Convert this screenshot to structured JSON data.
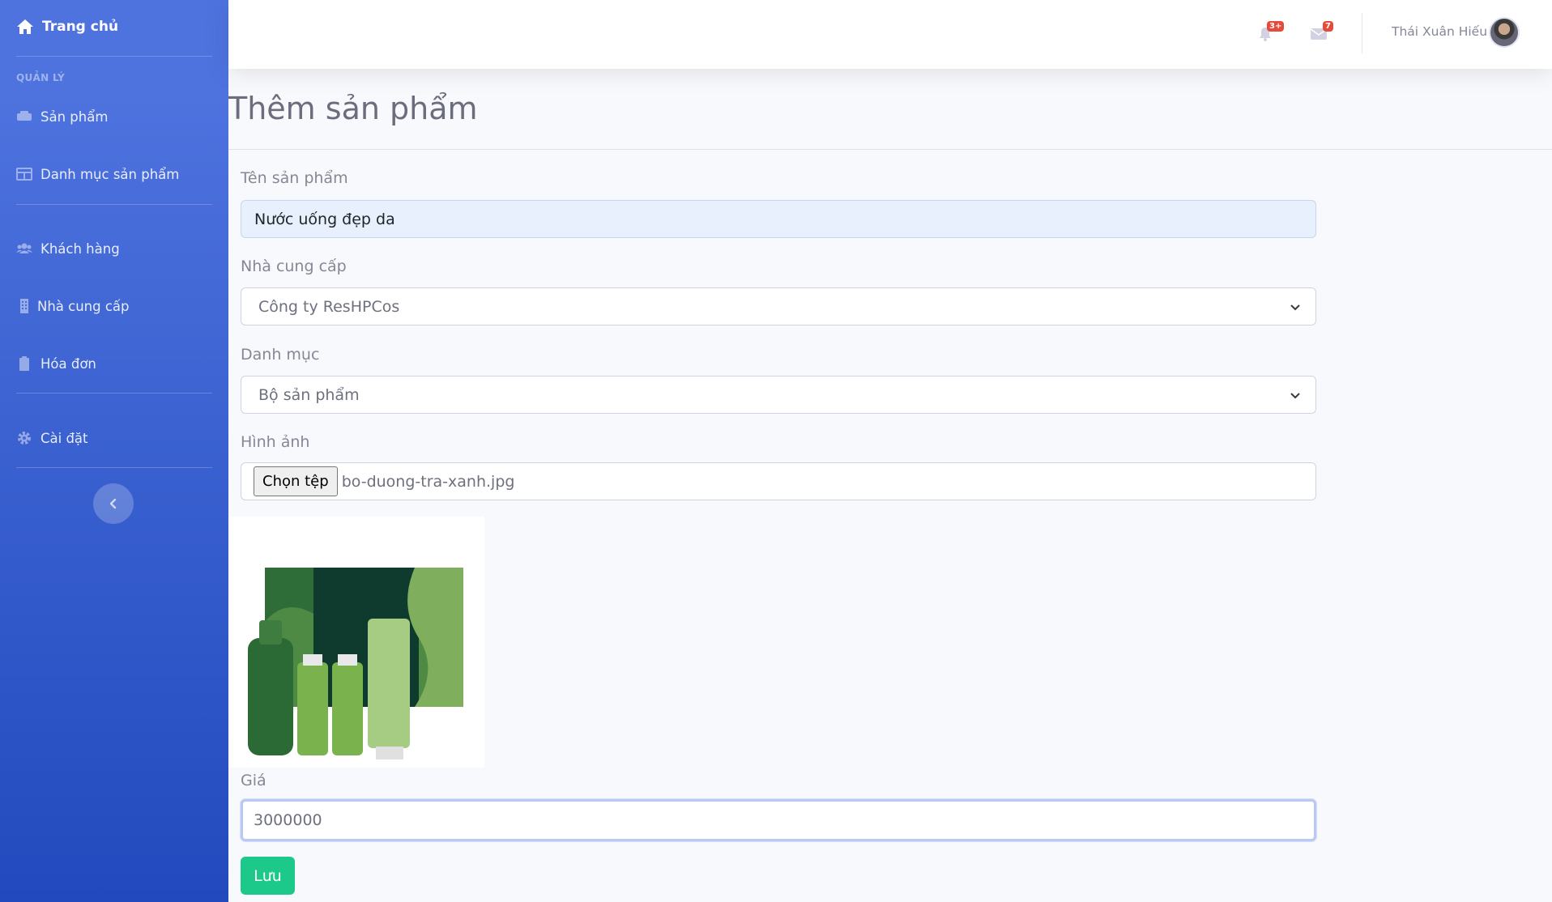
{
  "sidebar": {
    "brand": "Trang chủ",
    "section_heading": "QUẢN LÝ",
    "items": [
      {
        "label": "Sản phẩm",
        "icon": "boxes-icon"
      },
      {
        "label": "Danh mục sản phẩm",
        "icon": "table-icon"
      },
      {
        "label": "Khách hàng",
        "icon": "users-icon"
      },
      {
        "label": "Nhà cung cấp",
        "icon": "building-icon"
      },
      {
        "label": "Hóa đơn",
        "icon": "clipboard-icon"
      },
      {
        "label": "Cài đặt",
        "icon": "gear-icon"
      }
    ],
    "toggle_icon": "chevron-left-icon"
  },
  "topbar": {
    "alerts_badge": "3+",
    "messages_badge": "7",
    "user_name": "Thái Xuân Hiếu"
  },
  "page": {
    "title": "Thêm sản phẩm"
  },
  "form": {
    "name_label": "Tên sản phẩm",
    "name_value": "Nước uống đẹp da",
    "supplier_label": "Nhà cung cấp",
    "supplier_value": "Công ty ResHPCos",
    "category_label": "Danh mục",
    "category_value": "Bộ sản phẩm",
    "image_label": "Hình ảnh",
    "file_button": "Chọn tệp",
    "file_name": "bo-duong-tra-xanh.jpg",
    "price_label": "Giá",
    "price_value": "3000000",
    "save_button": "Lưu"
  },
  "colors": {
    "sidebar_top": "#4e73df",
    "sidebar_bottom": "#224abe",
    "badge": "#e74a3b",
    "save_button": "#1cc88a"
  }
}
